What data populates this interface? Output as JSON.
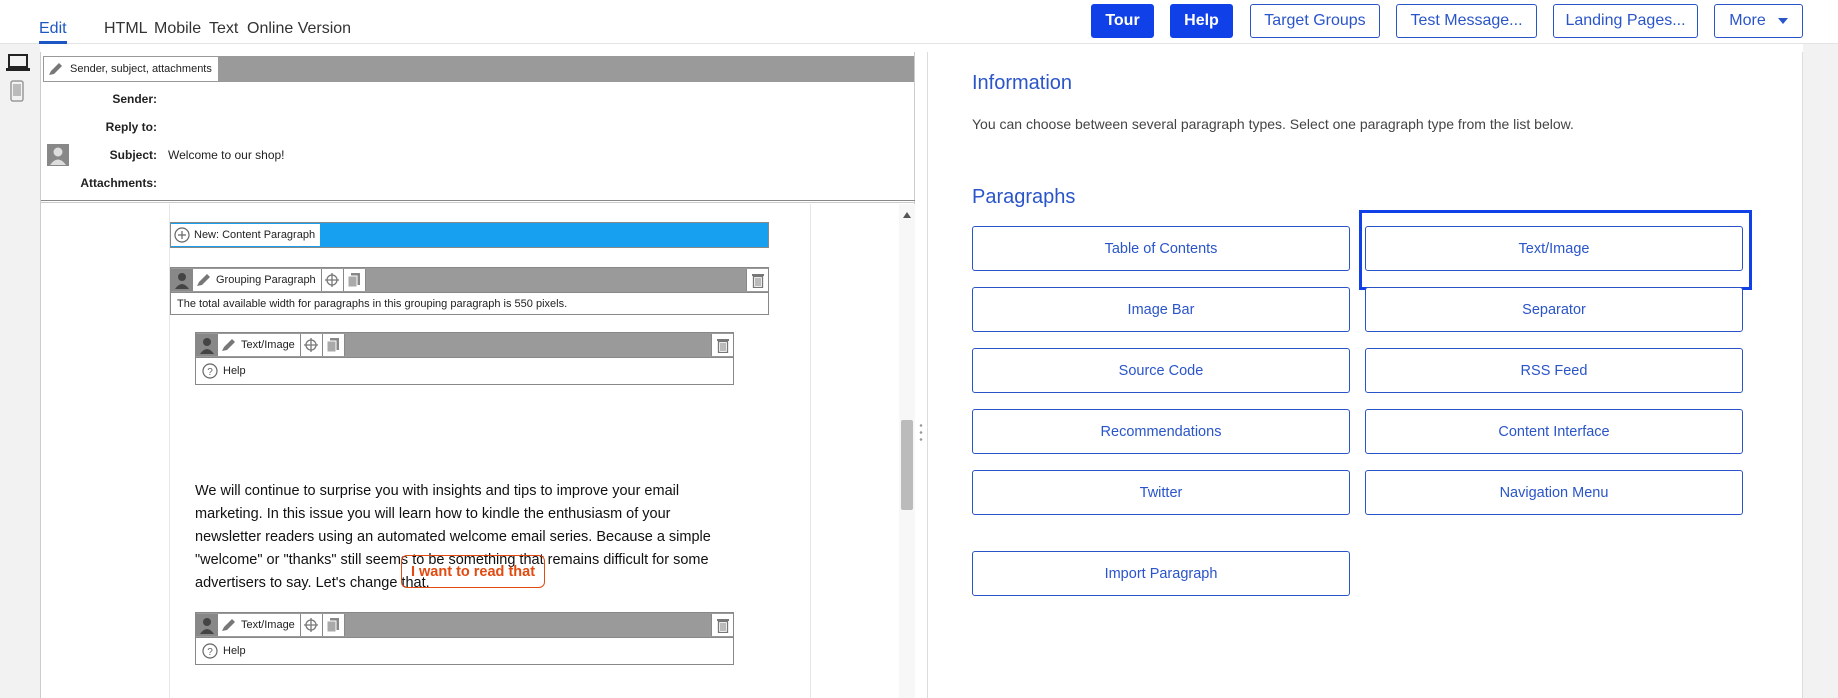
{
  "toolbar": {
    "tabs": [
      "Edit",
      "HTML",
      "Mobile",
      "Text",
      "Online Version"
    ],
    "tour_label": "Tour",
    "help_label": "Help",
    "target_groups_label": "Target Groups",
    "test_message_label": "Test Message...",
    "landing_pages_label": "Landing Pages...",
    "more_label": "More"
  },
  "editor": {
    "header_bar_label": "Sender, subject, attachments",
    "meta": {
      "sender_key": "Sender:",
      "sender_value": "",
      "reply_to_key": "Reply to:",
      "reply_to_value": "",
      "subject_key": "Subject:",
      "subject_value": "Welcome to our shop!",
      "attachments_key": "Attachments:",
      "attachments_value": ""
    },
    "new_paragraph_label": "New: Content Paragraph",
    "grouping_label": "Grouping Paragraph",
    "grouping_info": "The total available width for paragraphs in this grouping paragraph is 550 pixels.",
    "textimage_label": "Text/Image",
    "help_label": "Help",
    "body_text": "We will continue to surprise you with insights and tips to improve your email marketing. In this issue you will learn how to kindle the enthusiasm of your newsletter readers using an automated welcome email series. Because a simple \"welcome\" or \"thanks\" still seems to be something that remains difficult for some advertisers to say. Let's change that.",
    "cta_label": "I want to read that"
  },
  "panel": {
    "info_heading": "Information",
    "info_text": "You can choose between several paragraph types. Select one paragraph type from the list below.",
    "paragraphs_heading": "Paragraphs",
    "buttons": {
      "toc": "Table of Contents",
      "text_image": "Text/Image",
      "image_bar": "Image Bar",
      "separator": "Separator",
      "source_code": "Source Code",
      "rss_feed": "RSS Feed",
      "recommendations": "Recommendations",
      "content_interface": "Content Interface",
      "twitter": "Twitter",
      "navigation_menu": "Navigation Menu",
      "import_paragraph": "Import Paragraph"
    }
  },
  "colors": {
    "accent": "#1040e8",
    "link": "#2a55c9",
    "cta": "#e24a10",
    "new_bar": "#18a0f0",
    "bar_grey": "#9a9a9a"
  }
}
